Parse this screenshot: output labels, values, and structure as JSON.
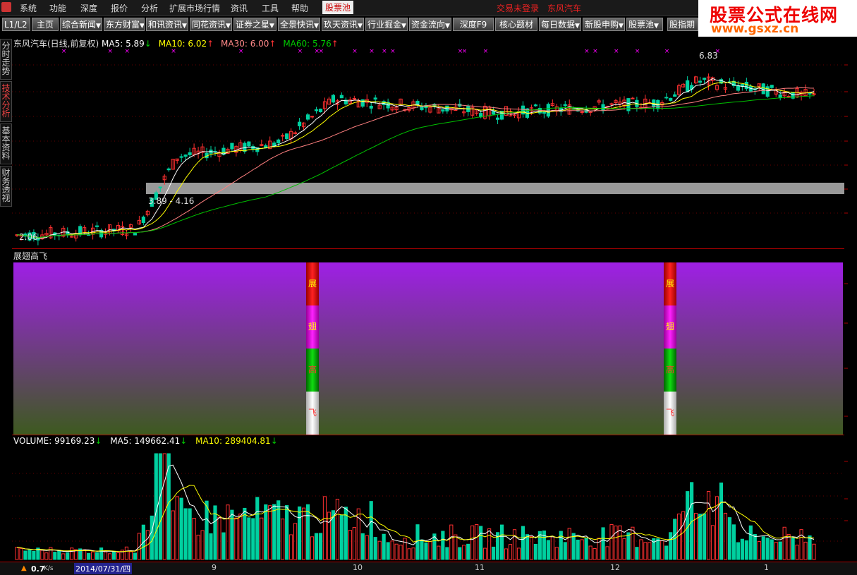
{
  "menu": {
    "items": [
      "系统",
      "功能",
      "深度",
      "报价",
      "分析",
      "扩展市场行情",
      "资讯",
      "工具",
      "帮助",
      "股票池"
    ],
    "status_login": "交易未登录",
    "status_stock": "东风汽车"
  },
  "toolbar": {
    "buttons": [
      "L1/L2",
      "主页",
      "综合新闻",
      "东方财富",
      "和讯资讯",
      "同花资讯",
      "证券之星",
      "全景快讯",
      "玖天资讯",
      "行业掘金",
      "资金流向",
      "深度F9",
      "核心题材",
      "每日数据",
      "新股申购",
      "股票池",
      "股指期"
    ]
  },
  "watermark": {
    "title": "股票公式在线网",
    "url": "www.gsxz.cn"
  },
  "side_tabs": [
    "分时走势",
    "技术分析",
    "基本资料",
    "财务透视"
  ],
  "main_chart": {
    "title": "东风汽车(日线,前复权)",
    "ma5": "MA5: 5.89",
    "ma10": "MA10: 6.02",
    "ma30": "MA30: 6.00",
    "ma60": "MA60: 5.76",
    "annot_high": "6.83",
    "annot_range": "3.89 - 4.16",
    "annot_low": "2.06",
    "colors": {
      "ma5": "#ffffff",
      "ma10": "#ffff00",
      "ma30": "#ff8080",
      "ma60": "#00c000",
      "up": "#ff3030",
      "down": "#00d0a0",
      "marker": "#ff00ff"
    }
  },
  "indicator": {
    "title": "展翅高飞",
    "labels": [
      "展",
      "翅",
      "高",
      "飞"
    ]
  },
  "volume": {
    "vol": "VOLUME: 99169.23",
    "ma5": "MA5: 149662.41",
    "ma10": "MA10: 289404.81"
  },
  "axis": {
    "months": [
      "9",
      "10",
      "11",
      "12",
      "1"
    ],
    "date": "2014/07/31/四"
  },
  "bottom": {
    "speed": "0.7",
    "speed_unit": "K/s"
  },
  "chart_data": {
    "type": "candlestick",
    "title": "东风汽车(日线,前复权)",
    "price_high": 6.83,
    "price_low": 2.06,
    "ma_values": {
      "MA5": 5.89,
      "MA10": 6.02,
      "MA30": 6.0,
      "MA60": 5.76
    },
    "volume_values": {
      "VOLUME": 99169.23,
      "MA5": 149662.41,
      "MA10": 289404.81
    },
    "x_ticks": [
      "9",
      "10",
      "11",
      "12",
      "1"
    ]
  }
}
